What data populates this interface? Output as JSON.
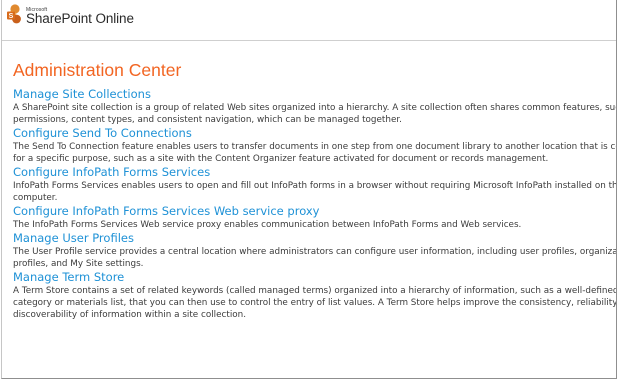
{
  "header": {
    "brand_small": "Microsoft",
    "brand": "SharePoint Online",
    "brand_color": "#d86b1b"
  },
  "main": {
    "title": "Administration Center",
    "title_color": "#f26522",
    "link_color": "#1e91d6",
    "sections": [
      {
        "title": "Manage Site Collections",
        "description": [
          "A SharePoint site collection is a group of related Web sites organized into a hierarchy. A site collection often shares common features, such",
          "permissions, content types, and consistent navigation, which can be managed together."
        ]
      },
      {
        "title": "Configure Send To Connections",
        "description": [
          "The Send To Connection feature enables users to transfer documents in one step from one document library to another location that is confi",
          "for a specific purpose, such as a site with the Content Organizer feature activated for document or records management."
        ]
      },
      {
        "title": "Configure InfoPath Forms Services",
        "description": [
          "InfoPath Forms Services enables users to open and fill out InfoPath forms in a browser without requiring Microsoft InfoPath installed on their",
          "computer."
        ]
      },
      {
        "title": "Configure InfoPath Forms Services Web service proxy",
        "description": [
          "The InfoPath Forms Services Web service proxy enables communication between InfoPath Forms and Web services."
        ]
      },
      {
        "title": "Manage User Profiles",
        "description": [
          "The User Profile service provides a central location where administrators can configure user information, including user profiles, organization",
          "profiles, and My Site settings."
        ]
      },
      {
        "title": "Manage Term Store",
        "description": [
          "A Term Store contains a set of related keywords (called managed terms) organized into a hierarchy of information, such as a well-defined pr",
          "category or materials list, that you can then use to control the entry of list values. A Term Store helps improve the consistency, reliability, and",
          "discoverability of information within a site collection."
        ]
      }
    ]
  }
}
